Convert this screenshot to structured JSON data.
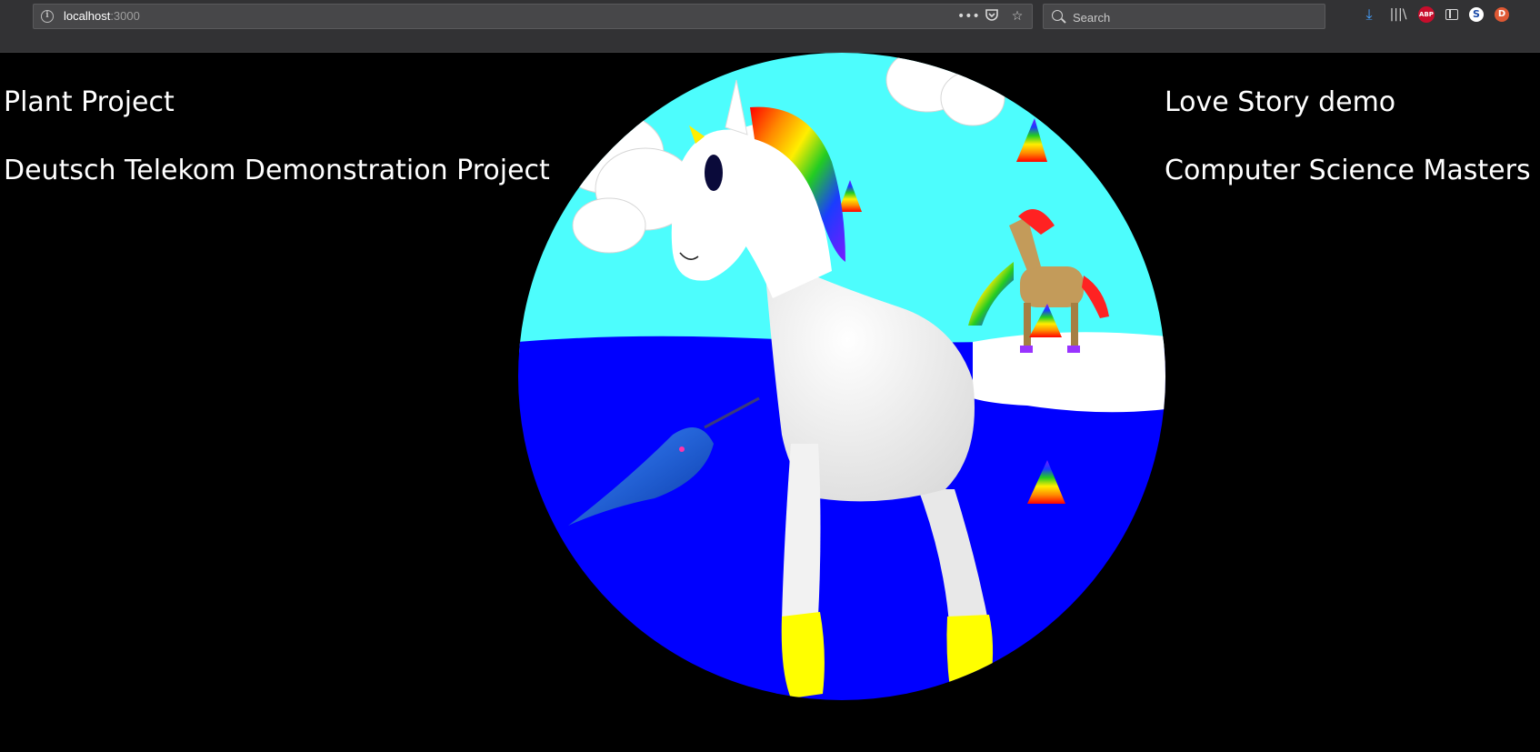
{
  "browser": {
    "url_host": "localhost",
    "url_port": ":3000",
    "search_placeholder": "Search",
    "icons": [
      "info-icon",
      "more-icon",
      "pocket-icon",
      "bookmark-star-icon",
      "search-icon",
      "download-icon",
      "library-icon",
      "adblock-icon",
      "sidebar-icon",
      "sync-icon",
      "duckduckgo-icon"
    ]
  },
  "page": {
    "links": {
      "plant": "Plant Project",
      "telekom": "Deutsch Telekom Demonstration Project",
      "love": "Love Story demo",
      "cs": "Computer Science Masters"
    },
    "scene": {
      "sky_color": "#4dfdfd",
      "sea_color": "#0000ff",
      "unicorn_color": "#ffffff",
      "hoof_color": "#ffff00",
      "horse_color": "#c39b5a",
      "narwhal_color": "#1a5fd8"
    }
  }
}
